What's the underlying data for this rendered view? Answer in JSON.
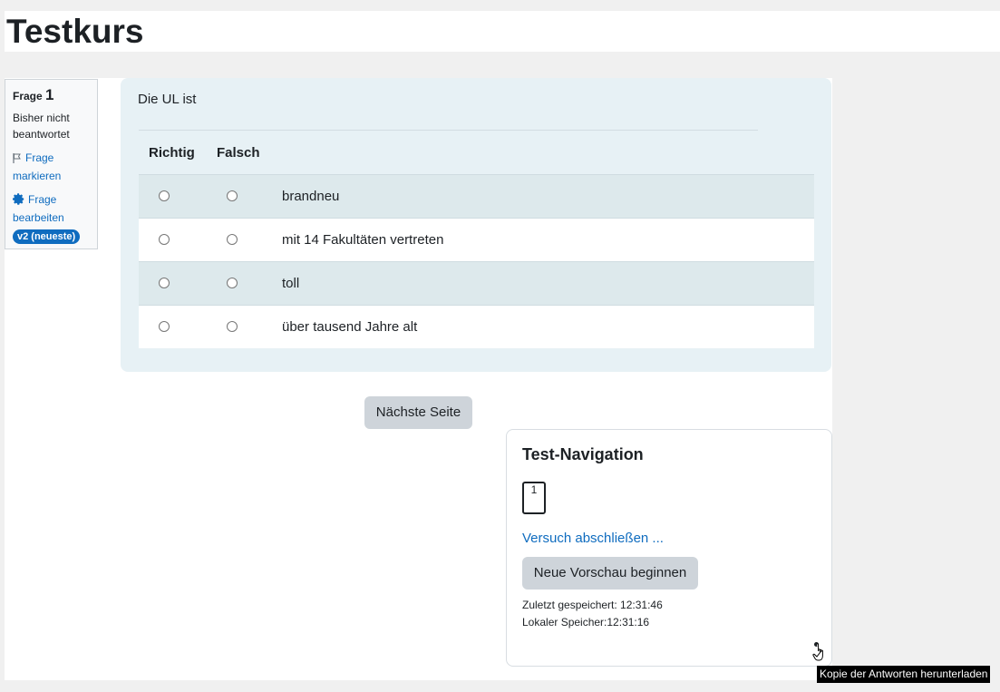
{
  "course": {
    "title": "Testkurs"
  },
  "question_info": {
    "label": "Frage",
    "number": "1",
    "state": "Bisher nicht beantwortet",
    "flag_label": "Frage markieren",
    "edit_label": "Frage bearbeiten",
    "version_badge": "v2 (neueste)"
  },
  "question": {
    "text": "Die UL ist",
    "col_true": "Richtig",
    "col_false": "Falsch",
    "rows": [
      {
        "label": "brandneu"
      },
      {
        "label": "mit 14 Fakultäten vertreten"
      },
      {
        "label": "toll"
      },
      {
        "label": "über tausend Jahre alt"
      }
    ]
  },
  "next_button": "Nächste Seite",
  "navigation": {
    "title": "Test-Navigation",
    "question_button": "1",
    "finish_link": "Versuch abschließen ...",
    "preview_button": "Neue Vorschau beginnen",
    "last_saved": "Zuletzt gespeichert: 12:31:46",
    "local_storage": "Lokaler Speicher:12:31:16"
  },
  "tooltip": "Kopie der Antworten herunterladen",
  "icons": {
    "flag": "flag-icon",
    "edit": "gear-icon",
    "cursor": "hand-pointer-icon"
  },
  "colors": {
    "link": "#0f6cbf",
    "question_bg": "#e7f1f5",
    "button_bg": "#ced4da"
  }
}
